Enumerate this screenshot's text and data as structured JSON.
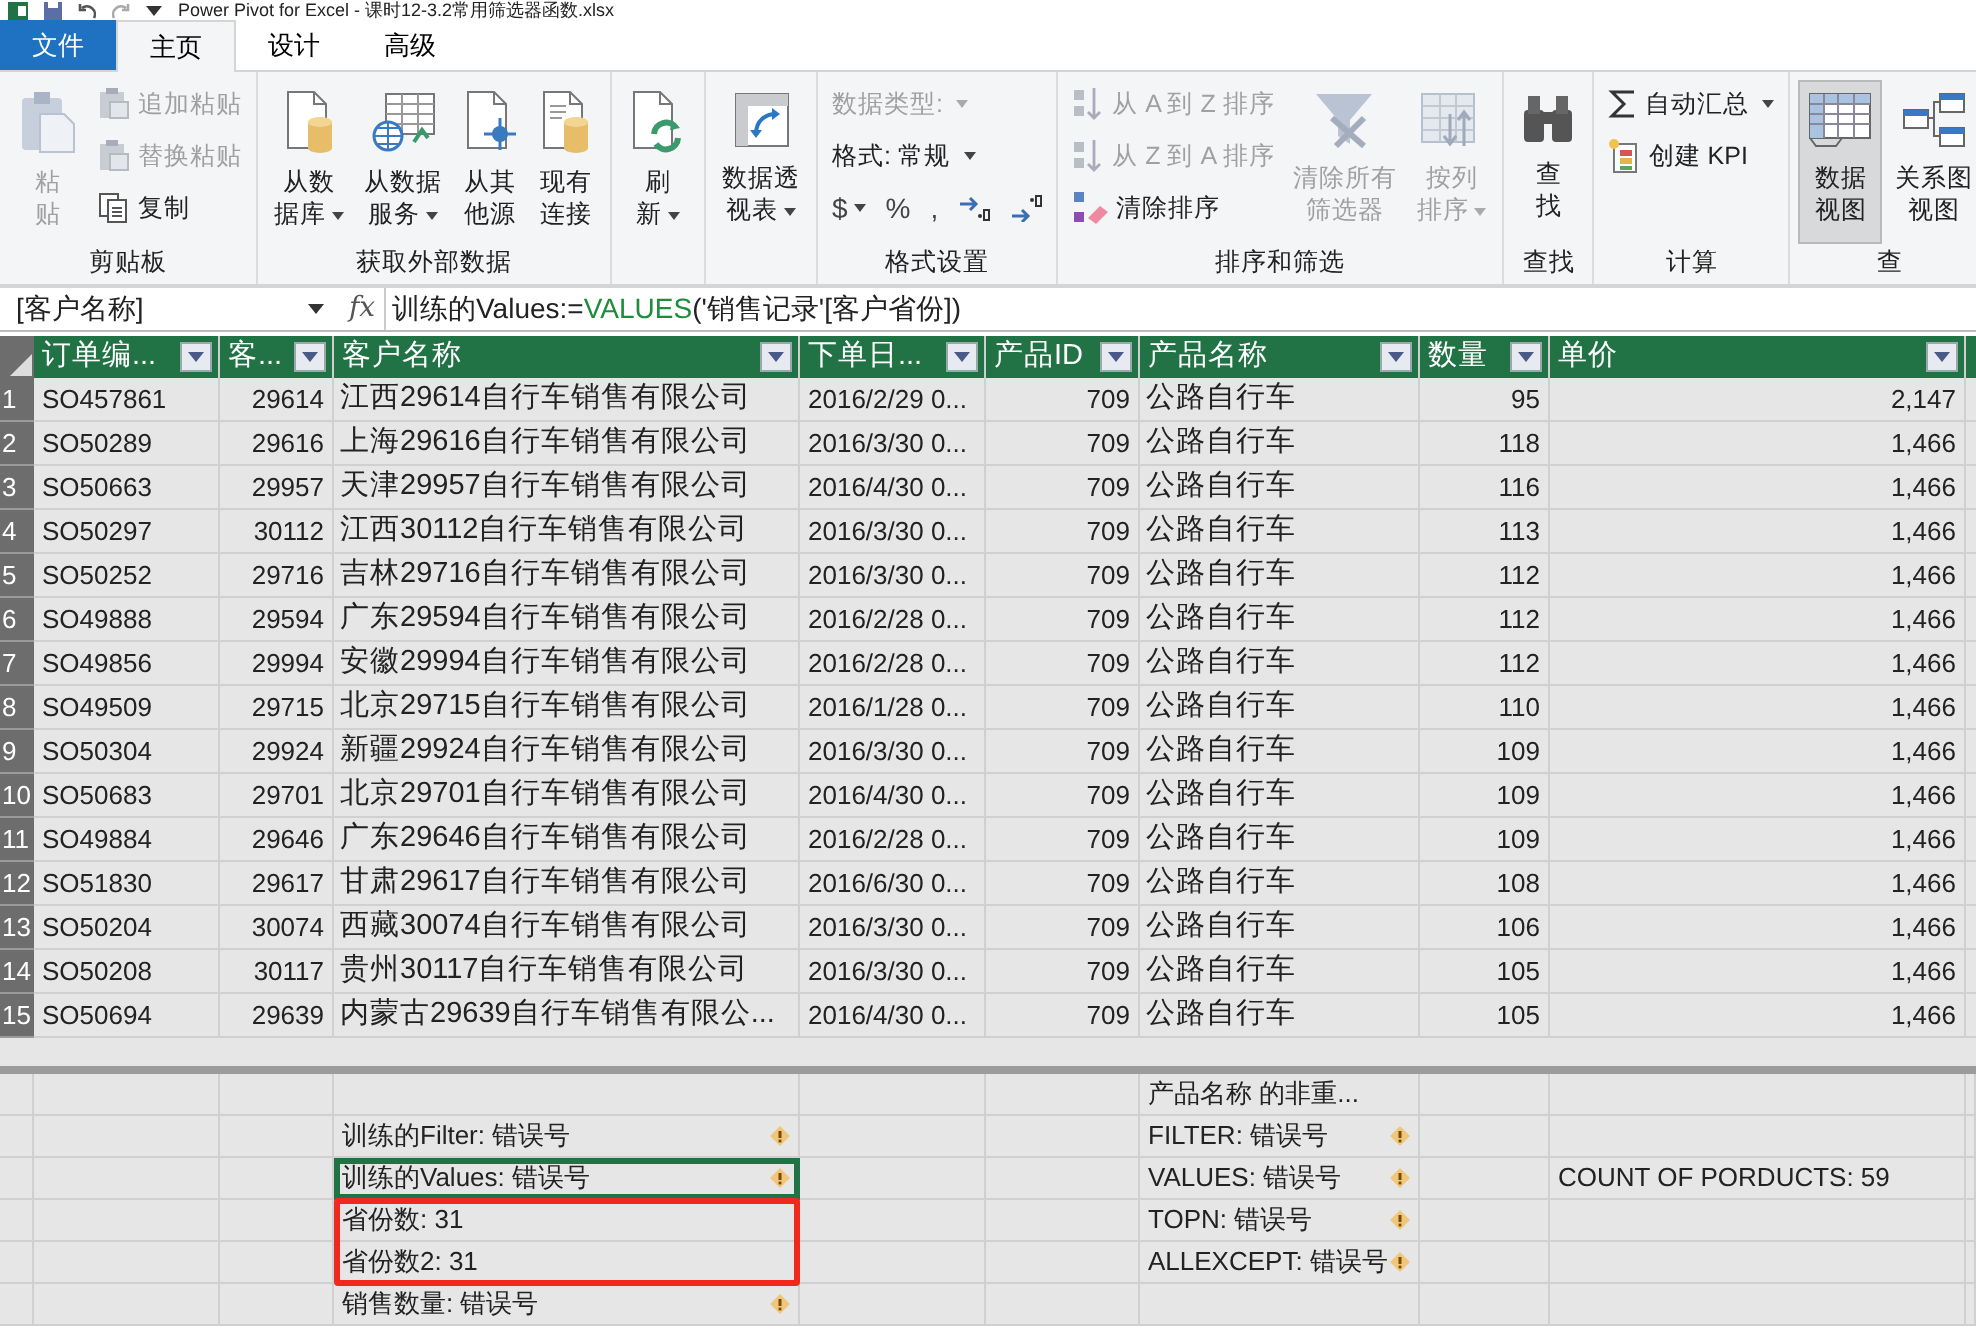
{
  "window": {
    "title": "Power Pivot for Excel - 课时12-3.2常用筛选器函数.xlsx"
  },
  "tabs": [
    {
      "label": "文件",
      "kind": "file",
      "selected": false
    },
    {
      "label": "主页",
      "kind": "tab",
      "selected": true
    },
    {
      "label": "设计",
      "kind": "tab",
      "selected": false
    },
    {
      "label": "高级",
      "kind": "tab",
      "selected": false
    }
  ],
  "ribbon": [
    {
      "label": "剪贴板",
      "items": [
        {
          "kind": "large",
          "lines": [
            "粘",
            "贴"
          ],
          "disabled": true,
          "dropdown": false,
          "selected": false
        },
        {
          "kind": "small",
          "label": "追加粘贴",
          "disabled": true,
          "dropdown": false
        },
        {
          "kind": "small",
          "label": "替换粘贴",
          "disabled": true,
          "dropdown": false
        },
        {
          "kind": "small",
          "label": "复制",
          "disabled": false,
          "dropdown": false
        }
      ]
    },
    {
      "label": "获取外部数据",
      "items": [
        {
          "kind": "large",
          "lines": [
            "从数",
            "据库"
          ],
          "disabled": false,
          "dropdown": true,
          "selected": false
        },
        {
          "kind": "large",
          "lines": [
            "从数据",
            "服务"
          ],
          "disabled": false,
          "dropdown": true,
          "selected": false
        },
        {
          "kind": "large",
          "lines": [
            "从其",
            "他源"
          ],
          "disabled": false,
          "dropdown": false,
          "selected": false
        },
        {
          "kind": "large",
          "lines": [
            "现有",
            "连接"
          ],
          "disabled": false,
          "dropdown": false,
          "selected": false
        }
      ]
    },
    {
      "items": [
        {
          "kind": "large",
          "lines": [
            "刷",
            "新"
          ],
          "disabled": false,
          "dropdown": true,
          "selected": false
        }
      ]
    },
    {
      "items": [
        {
          "kind": "large",
          "lines": [
            "数据透",
            "视表"
          ],
          "disabled": false,
          "dropdown": true,
          "selected": false
        }
      ]
    },
    {
      "label": "格式设置",
      "items": [
        {
          "kind": "small",
          "label": "数据类型:",
          "disabled": true,
          "dropdown": true
        },
        {
          "kind": "small",
          "label": "格式: 常规",
          "disabled": false,
          "dropdown": true
        },
        {
          "kind": "symbols",
          "symbols": [
            "$",
            "%",
            ","
          ]
        }
      ]
    },
    {
      "label": "排序和筛选",
      "items": [
        {
          "kind": "small",
          "label": "从 A 到 Z 排序",
          "disabled": true,
          "dropdown": false
        },
        {
          "kind": "small",
          "label": "从 Z 到 A 排序",
          "disabled": true,
          "dropdown": false
        },
        {
          "kind": "small",
          "label": "清除排序",
          "disabled": false,
          "dropdown": false
        },
        {
          "kind": "large",
          "lines": [
            "清除所有",
            "筛选器"
          ],
          "disabled": true,
          "dropdown": false,
          "selected": false
        },
        {
          "kind": "large",
          "lines": [
            "按列",
            "排序"
          ],
          "disabled": true,
          "dropdown": true,
          "selected": false
        }
      ]
    },
    {
      "label": "查找",
      "items": [
        {
          "kind": "large",
          "lines": [
            "查",
            "找"
          ],
          "disabled": false,
          "dropdown": false,
          "selected": false
        }
      ]
    },
    {
      "label": "计算",
      "items": [
        {
          "kind": "small",
          "label": "自动汇总",
          "disabled": false,
          "dropdown": true
        },
        {
          "kind": "small",
          "label": "创建 KPI",
          "disabled": false,
          "dropdown": false
        }
      ]
    },
    {
      "label": "查",
      "items": [
        {
          "kind": "large",
          "lines": [
            "数据",
            "视图"
          ],
          "disabled": false,
          "dropdown": false,
          "selected": true
        },
        {
          "kind": "large",
          "lines": [
            "关系图",
            "视图"
          ],
          "disabled": false,
          "dropdown": false,
          "selected": false
        }
      ]
    }
  ],
  "formula_bar": {
    "name_box": "[客户名称]",
    "fx_label": "fx",
    "formula": [
      {
        "kind": "plain",
        "text": "训练的Values:="
      },
      {
        "kind": "function",
        "text": "VALUES"
      },
      {
        "kind": "plain",
        "text": "('销售记录'[客户省份])"
      }
    ]
  },
  "table": {
    "columns": [
      {
        "label": "订单编..."
      },
      {
        "label": "客..."
      },
      {
        "label": "客户名称"
      },
      {
        "label": "下单日..."
      },
      {
        "label": "产品ID"
      },
      {
        "label": "产品名称"
      },
      {
        "label": "数量"
      },
      {
        "label": "单价"
      }
    ],
    "rows": [
      {
        "number": "1",
        "cells": [
          "SO457861",
          "29614",
          "江西29614自行车销售有限公司",
          "2016/2/29 0...",
          "709",
          "公路自行车",
          "95",
          "2,147"
        ]
      },
      {
        "number": "2",
        "cells": [
          "SO50289",
          "29616",
          "上海29616自行车销售有限公司",
          "2016/3/30 0...",
          "709",
          "公路自行车",
          "118",
          "1,466"
        ]
      },
      {
        "number": "3",
        "cells": [
          "SO50663",
          "29957",
          "天津29957自行车销售有限公司",
          "2016/4/30 0...",
          "709",
          "公路自行车",
          "116",
          "1,466"
        ]
      },
      {
        "number": "4",
        "cells": [
          "SO50297",
          "30112",
          "江西30112自行车销售有限公司",
          "2016/3/30 0...",
          "709",
          "公路自行车",
          "113",
          "1,466"
        ]
      },
      {
        "number": "5",
        "cells": [
          "SO50252",
          "29716",
          "吉林29716自行车销售有限公司",
          "2016/3/30 0...",
          "709",
          "公路自行车",
          "112",
          "1,466"
        ]
      },
      {
        "number": "6",
        "cells": [
          "SO49888",
          "29594",
          "广东29594自行车销售有限公司",
          "2016/2/28 0...",
          "709",
          "公路自行车",
          "112",
          "1,466"
        ]
      },
      {
        "number": "7",
        "cells": [
          "SO49856",
          "29994",
          "安徽29994自行车销售有限公司",
          "2016/2/28 0...",
          "709",
          "公路自行车",
          "112",
          "1,466"
        ]
      },
      {
        "number": "8",
        "cells": [
          "SO49509",
          "29715",
          "北京29715自行车销售有限公司",
          "2016/1/28 0...",
          "709",
          "公路自行车",
          "110",
          "1,466"
        ]
      },
      {
        "number": "9",
        "cells": [
          "SO50304",
          "29924",
          "新疆29924自行车销售有限公司",
          "2016/3/30 0...",
          "709",
          "公路自行车",
          "109",
          "1,466"
        ]
      },
      {
        "number": "10",
        "cells": [
          "SO50683",
          "29701",
          "北京29701自行车销售有限公司",
          "2016/4/30 0...",
          "709",
          "公路自行车",
          "109",
          "1,466"
        ]
      },
      {
        "number": "11",
        "cells": [
          "SO49884",
          "29646",
          "广东29646自行车销售有限公司",
          "2016/2/28 0...",
          "709",
          "公路自行车",
          "109",
          "1,466"
        ]
      },
      {
        "number": "12",
        "cells": [
          "SO51830",
          "29617",
          "甘肃29617自行车销售有限公司",
          "2016/6/30 0...",
          "709",
          "公路自行车",
          "108",
          "1,466"
        ]
      },
      {
        "number": "13",
        "cells": [
          "SO50204",
          "30074",
          "西藏30074自行车销售有限公司",
          "2016/3/30 0...",
          "709",
          "公路自行车",
          "106",
          "1,466"
        ]
      },
      {
        "number": "14",
        "cells": [
          "SO50208",
          "30117",
          "贵州30117自行车销售有限公司",
          "2016/3/30 0...",
          "709",
          "公路自行车",
          "105",
          "1,466"
        ]
      },
      {
        "number": "15",
        "cells": [
          "SO50694",
          "29639",
          "内蒙古29639自行车销售有限公...",
          "2016/4/30 0...",
          "709",
          "公路自行车",
          "105",
          "1,466"
        ]
      }
    ]
  },
  "measure_grid": {
    "rows": [
      {
        "cells": [
          "",
          "",
          "",
          "",
          "",
          {
            "text": "产品名称 的非重...",
            "error": false,
            "selected": false,
            "highlighted": false
          },
          "",
          ""
        ]
      },
      {
        "cells": [
          "",
          "",
          {
            "text": "训练的Filter: 错误号",
            "error": true,
            "selected": false,
            "highlighted": false
          },
          "",
          "",
          {
            "text": "FILTER: 错误号",
            "error": true,
            "selected": false,
            "highlighted": false
          },
          "",
          ""
        ]
      },
      {
        "cells": [
          "",
          "",
          {
            "text": "训练的Values: 错误号",
            "error": true,
            "selected": true,
            "highlighted": false
          },
          "",
          "",
          {
            "text": "VALUES: 错误号",
            "error": true,
            "selected": false,
            "highlighted": false
          },
          "",
          {
            "text": "COUNT OF PORDUCTS: 59",
            "error": false,
            "selected": false,
            "highlighted": false
          }
        ]
      },
      {
        "cells": [
          "",
          "",
          {
            "text": "省份数: 31",
            "error": false,
            "selected": false,
            "highlighted": true
          },
          "",
          "",
          {
            "text": "TOPN: 错误号",
            "error": true,
            "selected": false,
            "highlighted": false
          },
          "",
          ""
        ]
      },
      {
        "cells": [
          "",
          "",
          {
            "text": "省份数2: 31",
            "error": false,
            "selected": false,
            "highlighted": true
          },
          "",
          "",
          {
            "text": "ALLEXCEPT: 错误号",
            "error": true,
            "selected": false,
            "highlighted": false
          },
          "",
          ""
        ]
      },
      {
        "cells": [
          "",
          "",
          {
            "text": "销售数量: 错误号",
            "error": true,
            "selected": false,
            "highlighted": false
          },
          "",
          "",
          "",
          "",
          ""
        ]
      }
    ]
  }
}
